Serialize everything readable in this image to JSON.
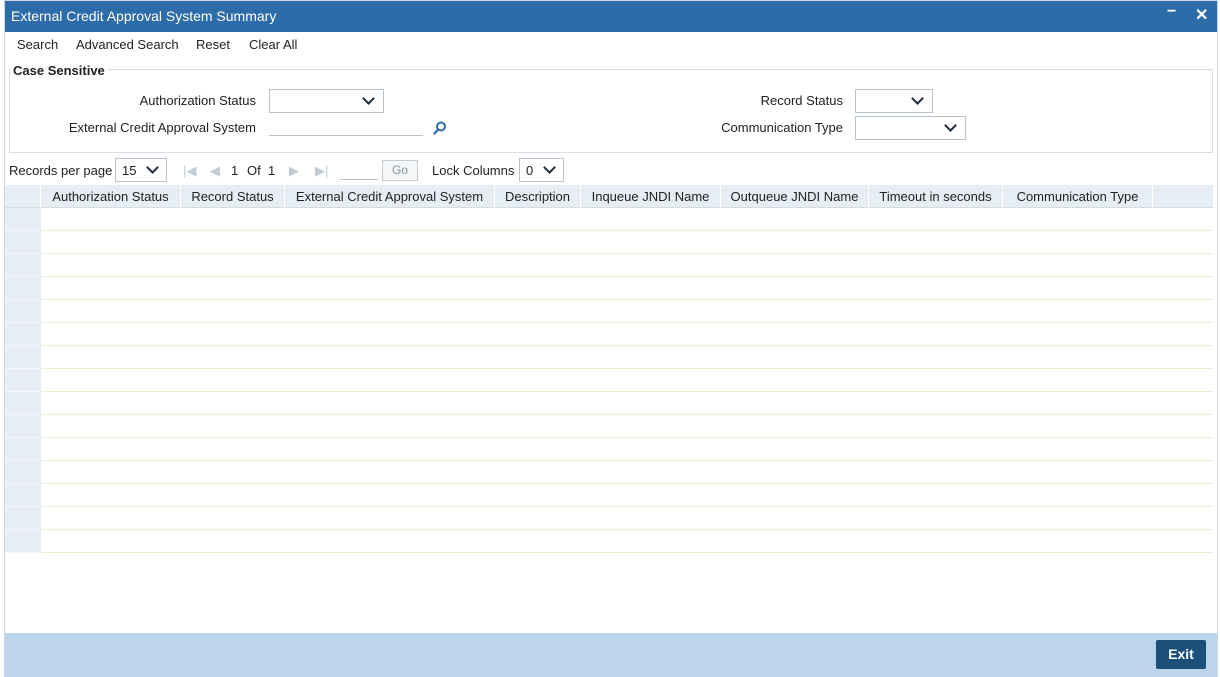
{
  "window": {
    "title": "External Credit Approval System Summary",
    "minimize_glyph": "−",
    "close_glyph": "✕"
  },
  "toolbar": {
    "search": "Search",
    "advanced_search": "Advanced Search",
    "reset": "Reset",
    "clear_all": "Clear All"
  },
  "criteria": {
    "legend": "Case Sensitive",
    "authorization_status_label": "Authorization Status",
    "authorization_status_value": "",
    "ecas_label": "External Credit Approval System",
    "ecas_value": "",
    "record_status_label": "Record Status",
    "record_status_value": "",
    "communication_type_label": "Communication Type",
    "communication_type_value": ""
  },
  "pager": {
    "records_per_page_label": "Records per page",
    "records_per_page_value": "15",
    "current_page": "1",
    "of_label": "Of",
    "total_pages": "1",
    "go_label": "Go",
    "lock_columns_label": "Lock Columns",
    "lock_columns_value": "0"
  },
  "grid": {
    "columns": [
      "Authorization Status",
      "Record Status",
      "External Credit Approval System",
      "Description",
      "Inqueue JNDI Name",
      "Outqueue JNDI Name",
      "Timeout in seconds",
      "Communication Type"
    ],
    "row_count": 15
  },
  "footer": {
    "exit_label": "Exit"
  },
  "colors": {
    "titlebar": "#2d6ca8",
    "footer": "#bcd5ec",
    "exit_button": "#1c4f7a",
    "grid_header": "#e6edf5"
  }
}
